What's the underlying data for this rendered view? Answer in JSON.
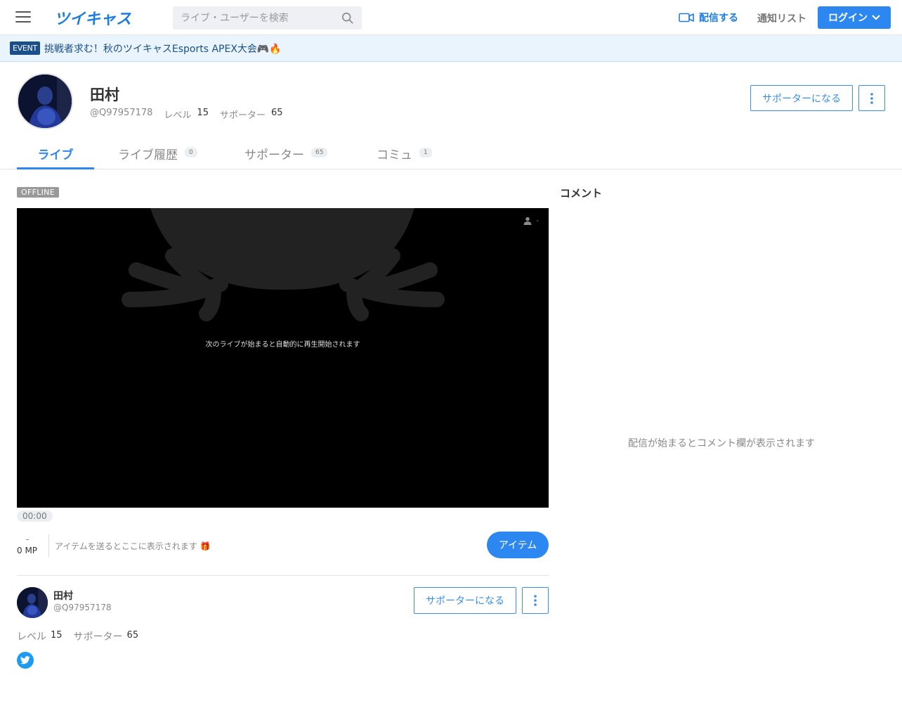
{
  "header": {
    "logo": "ツイキャス",
    "search_placeholder": "ライブ・ユーザーを検索",
    "broadcast_label": "配信する",
    "notify_label": "通知リスト",
    "login_label": "ログイン"
  },
  "event": {
    "badge": "EVENT",
    "text": "挑戦者求む！秋のツイキャスEsports APEX大会🎮🔥"
  },
  "profile": {
    "name": "田村",
    "id": "@Q97957178",
    "level_label": "レベル",
    "level": "15",
    "supporter_label": "サポーター",
    "supporters": "65",
    "supporter_button": "サポーターになる"
  },
  "tabs": [
    {
      "label": "ライブ",
      "count": ""
    },
    {
      "label": "ライブ履歴",
      "count": "0"
    },
    {
      "label": "サポーター",
      "count": "65"
    },
    {
      "label": "コミュ",
      "count": "1"
    }
  ],
  "player": {
    "status": "OFFLINE",
    "message": "次のライブが始まると自動的に再生開始されます",
    "viewers": "-",
    "time": "00:00"
  },
  "items": {
    "mp_dash": "-",
    "mp": "0 MP",
    "message": "アイテムを送るとここに表示されます 🎁",
    "button": "アイテム"
  },
  "user_card": {
    "name": "田村",
    "id": "@Q97957178",
    "level_label": "レベル",
    "level": "15",
    "supporter_label": "サポーター",
    "supporters": "65",
    "supporter_button": "サポーターになる"
  },
  "comments": {
    "title": "コメント",
    "empty": "配信が始まるとコメント欄が表示されます"
  },
  "colors": {
    "accent": "#2d87f0",
    "event_bg": "#eaf4fd",
    "player_bg": "#000000"
  }
}
